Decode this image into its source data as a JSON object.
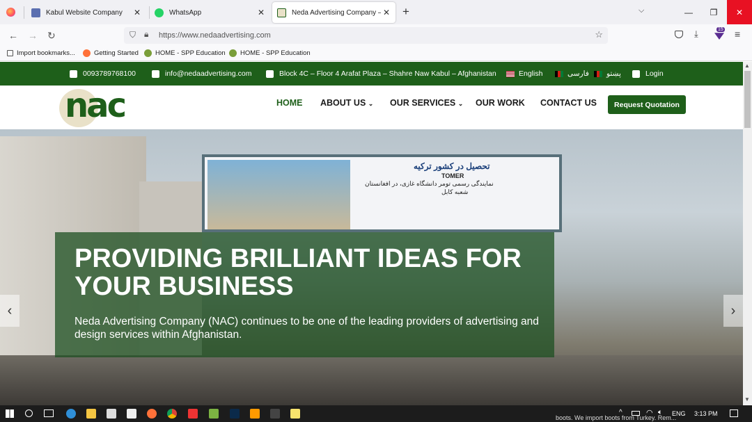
{
  "browser": {
    "tabs": [
      {
        "label": "Kabul Website Company",
        "active": false
      },
      {
        "label": "WhatsApp",
        "active": false
      },
      {
        "label": "Neda Advertising Company – Y",
        "active": true
      }
    ],
    "new_tab": "+",
    "url": "https://www.nedaadvertising.com",
    "extension_badge": "15",
    "bookmarks": [
      "Import bookmarks...",
      "Getting Started",
      "HOME - SPP Education",
      "HOME - SPP Education"
    ]
  },
  "site": {
    "topbar": {
      "phone": "0093789768100",
      "email": "info@nedaadvertising.com",
      "address": "Block 4C – Floor 4 Arafat Plaza – Shahre Naw Kabul – Afghanistan",
      "lang_en": "English",
      "lang_fa": "فارسی",
      "lang_ps": "پښتو",
      "login": "Login"
    },
    "logo": "nac",
    "menu": {
      "home": "HOME",
      "about": "ABOUT US",
      "services": "OUR SERVICES",
      "work": "OUR WORK",
      "contact": "CONTACT US",
      "quote": "Request Quotation"
    },
    "hero": {
      "title": "PROVIDING BRILLIANT IDEAS FOR YOUR BUSINESS",
      "text": "Neda Advertising Company (NAC) continues to be one of the leading providers of advertising and design services within Afghanistan.",
      "billboard_title": "تحصیل در کشور ترکیه",
      "billboard_sub": "TOMER",
      "billboard_line": "نمایندگی رسمی تومر دانشگاه غازی، در افغانستان",
      "billboard_city": "شعبه کابل"
    },
    "colors": {
      "brand": "#1e5f1a",
      "accent": "#e9e1c8"
    }
  },
  "taskbar": {
    "lang": "ENG",
    "time": "3:13 PM",
    "notification_text": "boots. We import boots from Turkey. Rem..."
  }
}
